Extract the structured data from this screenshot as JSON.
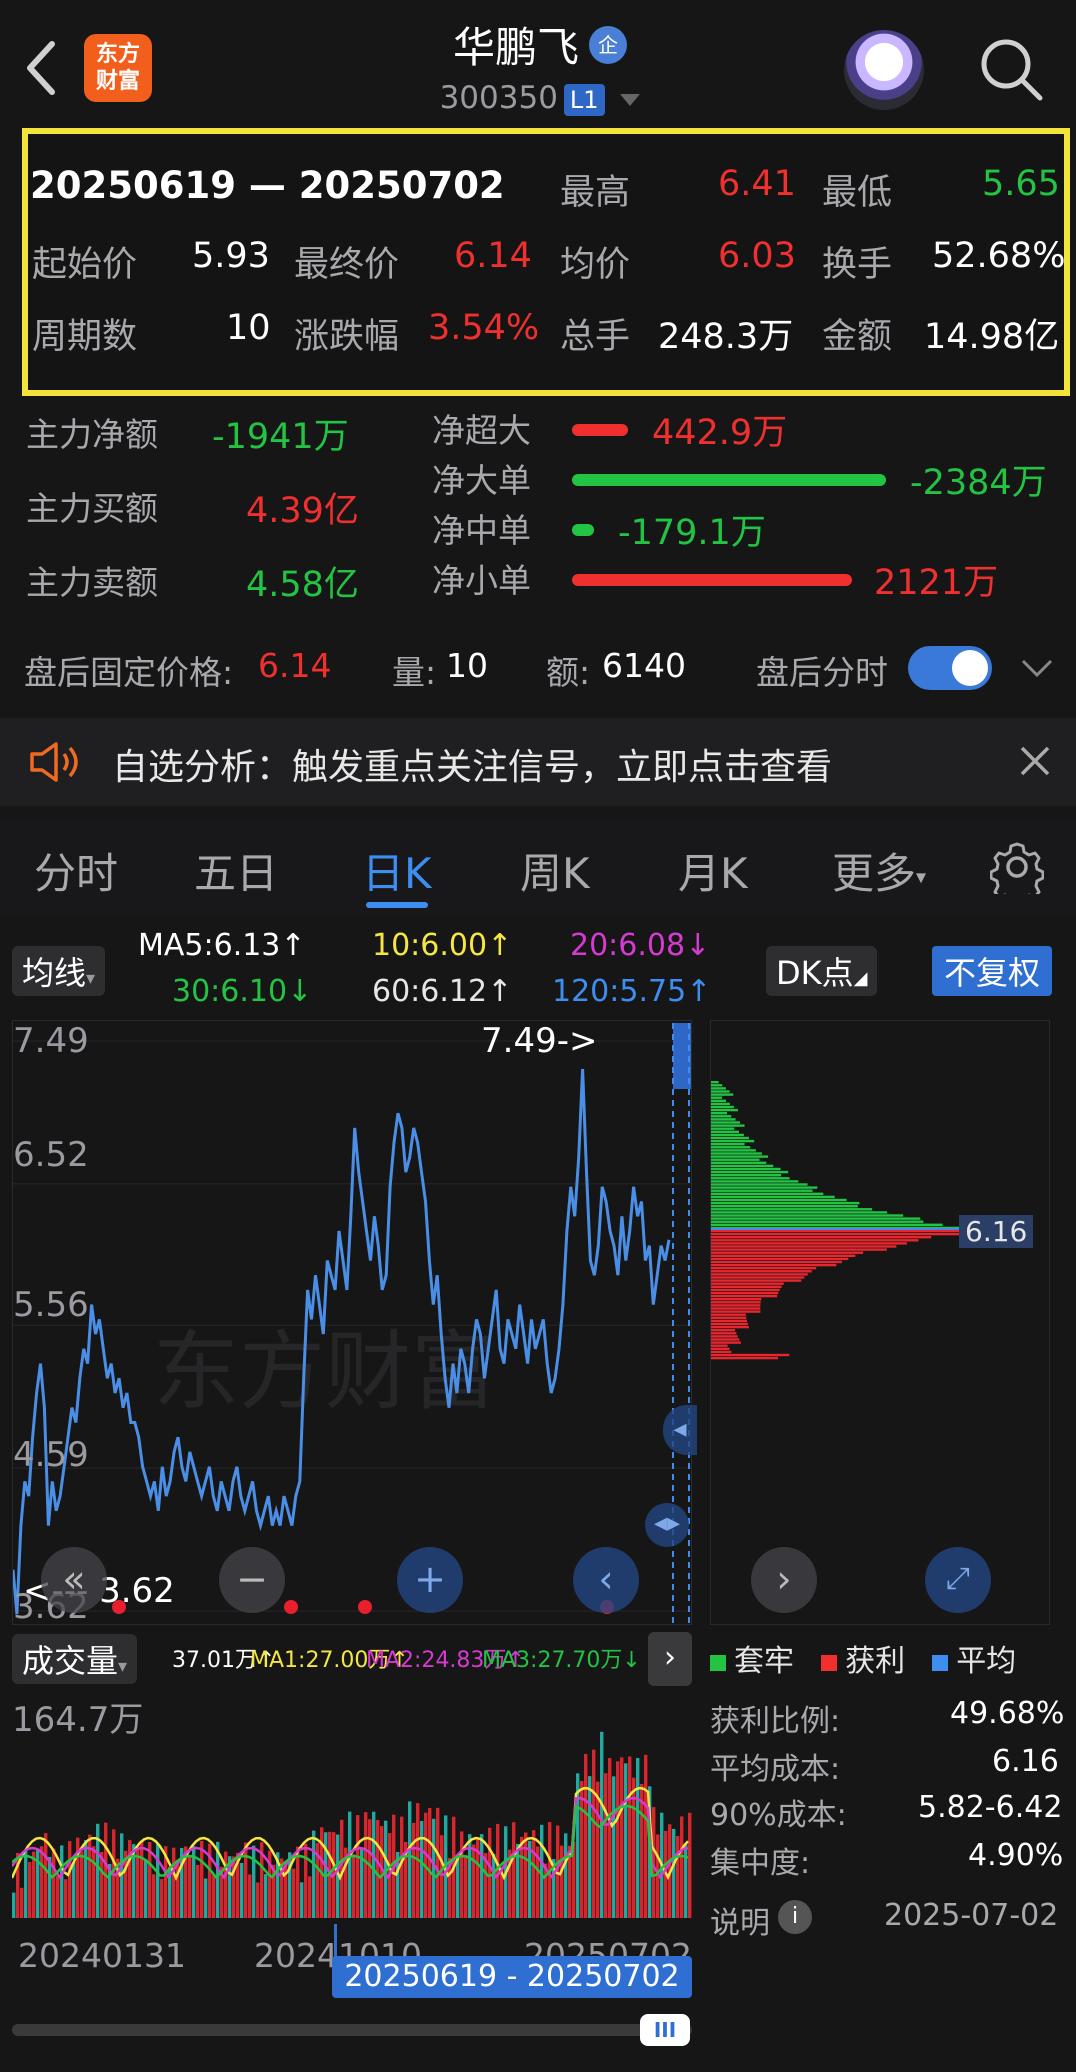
{
  "header": {
    "logo_line1": "东方",
    "logo_line2": "财富",
    "stock_name": "华鹏飞",
    "enterprise_badge": "企",
    "stock_code": "300350",
    "level": "L1"
  },
  "summary": {
    "range_text": "20250619 — 20250702",
    "high_label": "最高",
    "high": "6.41",
    "low_label": "最低",
    "low": "5.65",
    "open_label": "起始价",
    "open": "5.93",
    "close_label": "最终价",
    "close": "6.14",
    "avg_label": "均价",
    "avg": "6.03",
    "turnover_label": "换手",
    "turnover": "52.68%",
    "periods_label": "周期数",
    "periods": "10",
    "change_label": "涨跌幅",
    "change": "3.54%",
    "volume_label": "总手",
    "volume": "248.3万",
    "amount_label": "金额",
    "amount": "14.98亿"
  },
  "flows": {
    "main_net_label": "主力净额",
    "main_net": "-1941万",
    "main_buy_label": "主力买额",
    "main_buy": "4.39亿",
    "main_sell_label": "主力卖额",
    "main_sell": "4.58亿",
    "super_label": "净超大",
    "super": "442.9万",
    "large_label": "净大单",
    "large": "-2384万",
    "medium_label": "净中单",
    "medium": "-179.1万",
    "small_label": "净小单",
    "small": "2121万"
  },
  "postmarket": {
    "fixed_label": "盘后固定价格:",
    "fixed": "6.14",
    "vol_label": "量:",
    "vol": "10",
    "amt_label": "额:",
    "amt": "6140",
    "toggle_label": "盘后分时"
  },
  "notice": {
    "text": "自选分析：触发重点关注信号，立即点击查看"
  },
  "tabs": [
    "分时",
    "五日",
    "日K",
    "周K",
    "月K",
    "更多"
  ],
  "indicators": {
    "selector": "均线",
    "ma5": "MA5:6.13↑",
    "ma10": "10:6.00↑",
    "ma20": "20:6.08↓",
    "ma30": "30:6.10↓",
    "ma60": "60:6.12↑",
    "ma120": "120:5.75↑",
    "dk": "DK点",
    "adjust": "不复权"
  },
  "chart_data": {
    "type": "line",
    "price_ticks": [
      "7.49",
      "6.52",
      "5.56",
      "4.59",
      "3.62"
    ],
    "max_annotation": "7.49->",
    "min_annotation": "<--- 3.62",
    "cost_marker": "6.16",
    "ylim": [
      3.62,
      7.49
    ],
    "close": [
      3.9,
      3.6,
      4.2,
      4.5,
      4.4,
      4.8,
      5.1,
      5.3,
      5.0,
      4.2,
      4.5,
      4.3,
      4.4,
      4.6,
      4.8,
      5.0,
      4.9,
      5.2,
      5.4,
      5.3,
      5.7,
      5.5,
      5.6,
      5.4,
      5.2,
      5.3,
      5.1,
      5.2,
      5.0,
      5.1,
      4.9,
      4.9,
      4.8,
      4.6,
      4.5,
      4.4,
      4.5,
      4.3,
      4.6,
      4.4,
      4.5,
      4.7,
      4.8,
      4.6,
      4.5,
      4.7,
      4.6,
      4.5,
      4.4,
      4.5,
      4.6,
      4.4,
      4.3,
      4.5,
      4.4,
      4.3,
      4.5,
      4.6,
      4.4,
      4.3,
      4.4,
      4.5,
      4.3,
      4.2,
      4.3,
      4.4,
      4.2,
      4.3,
      4.2,
      4.4,
      4.3,
      4.2,
      4.4,
      4.5,
      5.2,
      5.8,
      5.6,
      5.9,
      5.7,
      5.5,
      6.0,
      5.9,
      5.8,
      6.2,
      6.0,
      5.8,
      6.3,
      6.9,
      6.6,
      6.4,
      6.2,
      6.0,
      6.3,
      6.1,
      5.8,
      5.9,
      6.5,
      6.8,
      7.0,
      6.9,
      6.6,
      6.7,
      6.9,
      6.8,
      6.6,
      6.4,
      6.0,
      5.7,
      5.9,
      5.5,
      5.2,
      5.0,
      5.3,
      5.1,
      5.4,
      5.3,
      5.1,
      5.4,
      5.6,
      5.5,
      5.2,
      5.4,
      5.6,
      5.8,
      5.4,
      5.3,
      5.6,
      5.5,
      5.4,
      5.7,
      5.5,
      5.3,
      5.6,
      5.4,
      5.5,
      5.6,
      5.3,
      5.1,
      5.2,
      5.4,
      5.7,
      6.2,
      6.5,
      6.3,
      6.7,
      7.3,
      6.6,
      6.0,
      5.9,
      6.1,
      6.5,
      6.4,
      6.2,
      6.1,
      5.9,
      6.3,
      6.0,
      6.2,
      6.5,
      6.3,
      6.4,
      6.0,
      6.1,
      5.7,
      5.9,
      6.1,
      6.0,
      6.14
    ],
    "volume_label": "成交量",
    "vol_max_label": "164.7万",
    "vol_series": [
      "37.01万↑",
      "MA1:27.00万↑",
      "MA2:24.83万↑",
      "MA3:27.70万↓"
    ],
    "dates": [
      "20240131",
      "20241010",
      "20250702"
    ],
    "selected_range": "20250619 - 20250702"
  },
  "distribution": {
    "legend": [
      "套牢",
      "获利",
      "平均"
    ],
    "profit_ratio_label": "获利比例:",
    "profit_ratio": "49.68%",
    "avg_cost_label": "平均成本:",
    "avg_cost": "6.16",
    "cost90_label": "90%成本:",
    "cost90": "5.82-6.42",
    "concentration_label": "集中度:",
    "concentration": "4.90%",
    "explain_label": "说明",
    "date": "2025-07-02"
  },
  "colors": {
    "up": "#f0302f",
    "down": "#23c343",
    "accent": "#3d8ef0",
    "highlight": "#f4e43a"
  }
}
